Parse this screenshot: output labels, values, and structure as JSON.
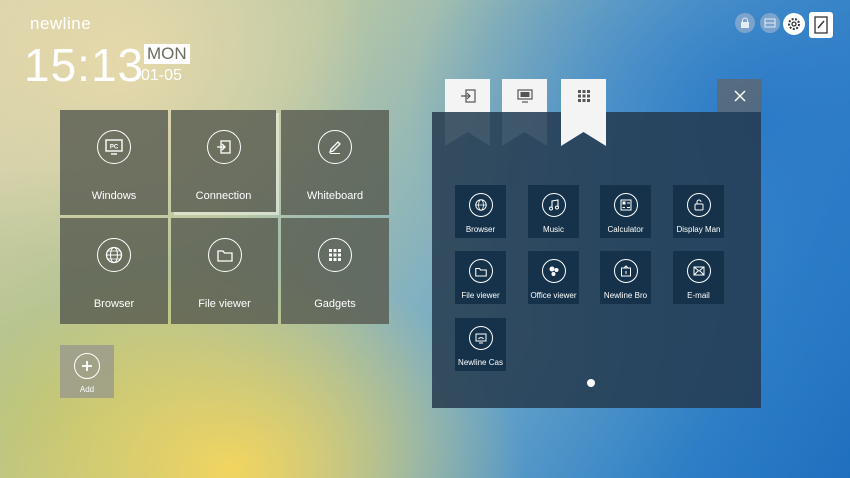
{
  "brand": "newline",
  "clock": {
    "time": "15:13",
    "day": "MON",
    "date": "01-05"
  },
  "tiles": [
    {
      "label": "Windows",
      "icon": "pc-icon"
    },
    {
      "label": "Connection",
      "icon": "input-icon"
    },
    {
      "label": "Whiteboard",
      "icon": "pen-icon"
    },
    {
      "label": "Browser",
      "icon": "globe-icon"
    },
    {
      "label": "File viewer",
      "icon": "folder-icon"
    },
    {
      "label": "Gadgets",
      "icon": "grid-icon"
    }
  ],
  "add": {
    "label": "Add"
  },
  "tray": {
    "pc_badge": "PC"
  },
  "gadgets": [
    {
      "label": "Browser",
      "icon": "globe-icon"
    },
    {
      "label": "Music",
      "icon": "music-icon"
    },
    {
      "label": "Calculator",
      "icon": "calculator-icon"
    },
    {
      "label": "Display Man",
      "icon": "display-manager-icon"
    },
    {
      "label": "File viewer",
      "icon": "folder-icon"
    },
    {
      "label": "Office viewer",
      "icon": "office-icon"
    },
    {
      "label": "Newline Bro",
      "icon": "broadcast-icon"
    },
    {
      "label": "E-mail",
      "icon": "mail-icon"
    },
    {
      "label": "Newline Cas",
      "icon": "cast-icon"
    }
  ],
  "panel_tabs": [
    "input-tab",
    "display-tab",
    "gadgets-tab"
  ],
  "active_tab": "gadgets-tab",
  "page_indicator": {
    "current": 1,
    "total": 1
  }
}
